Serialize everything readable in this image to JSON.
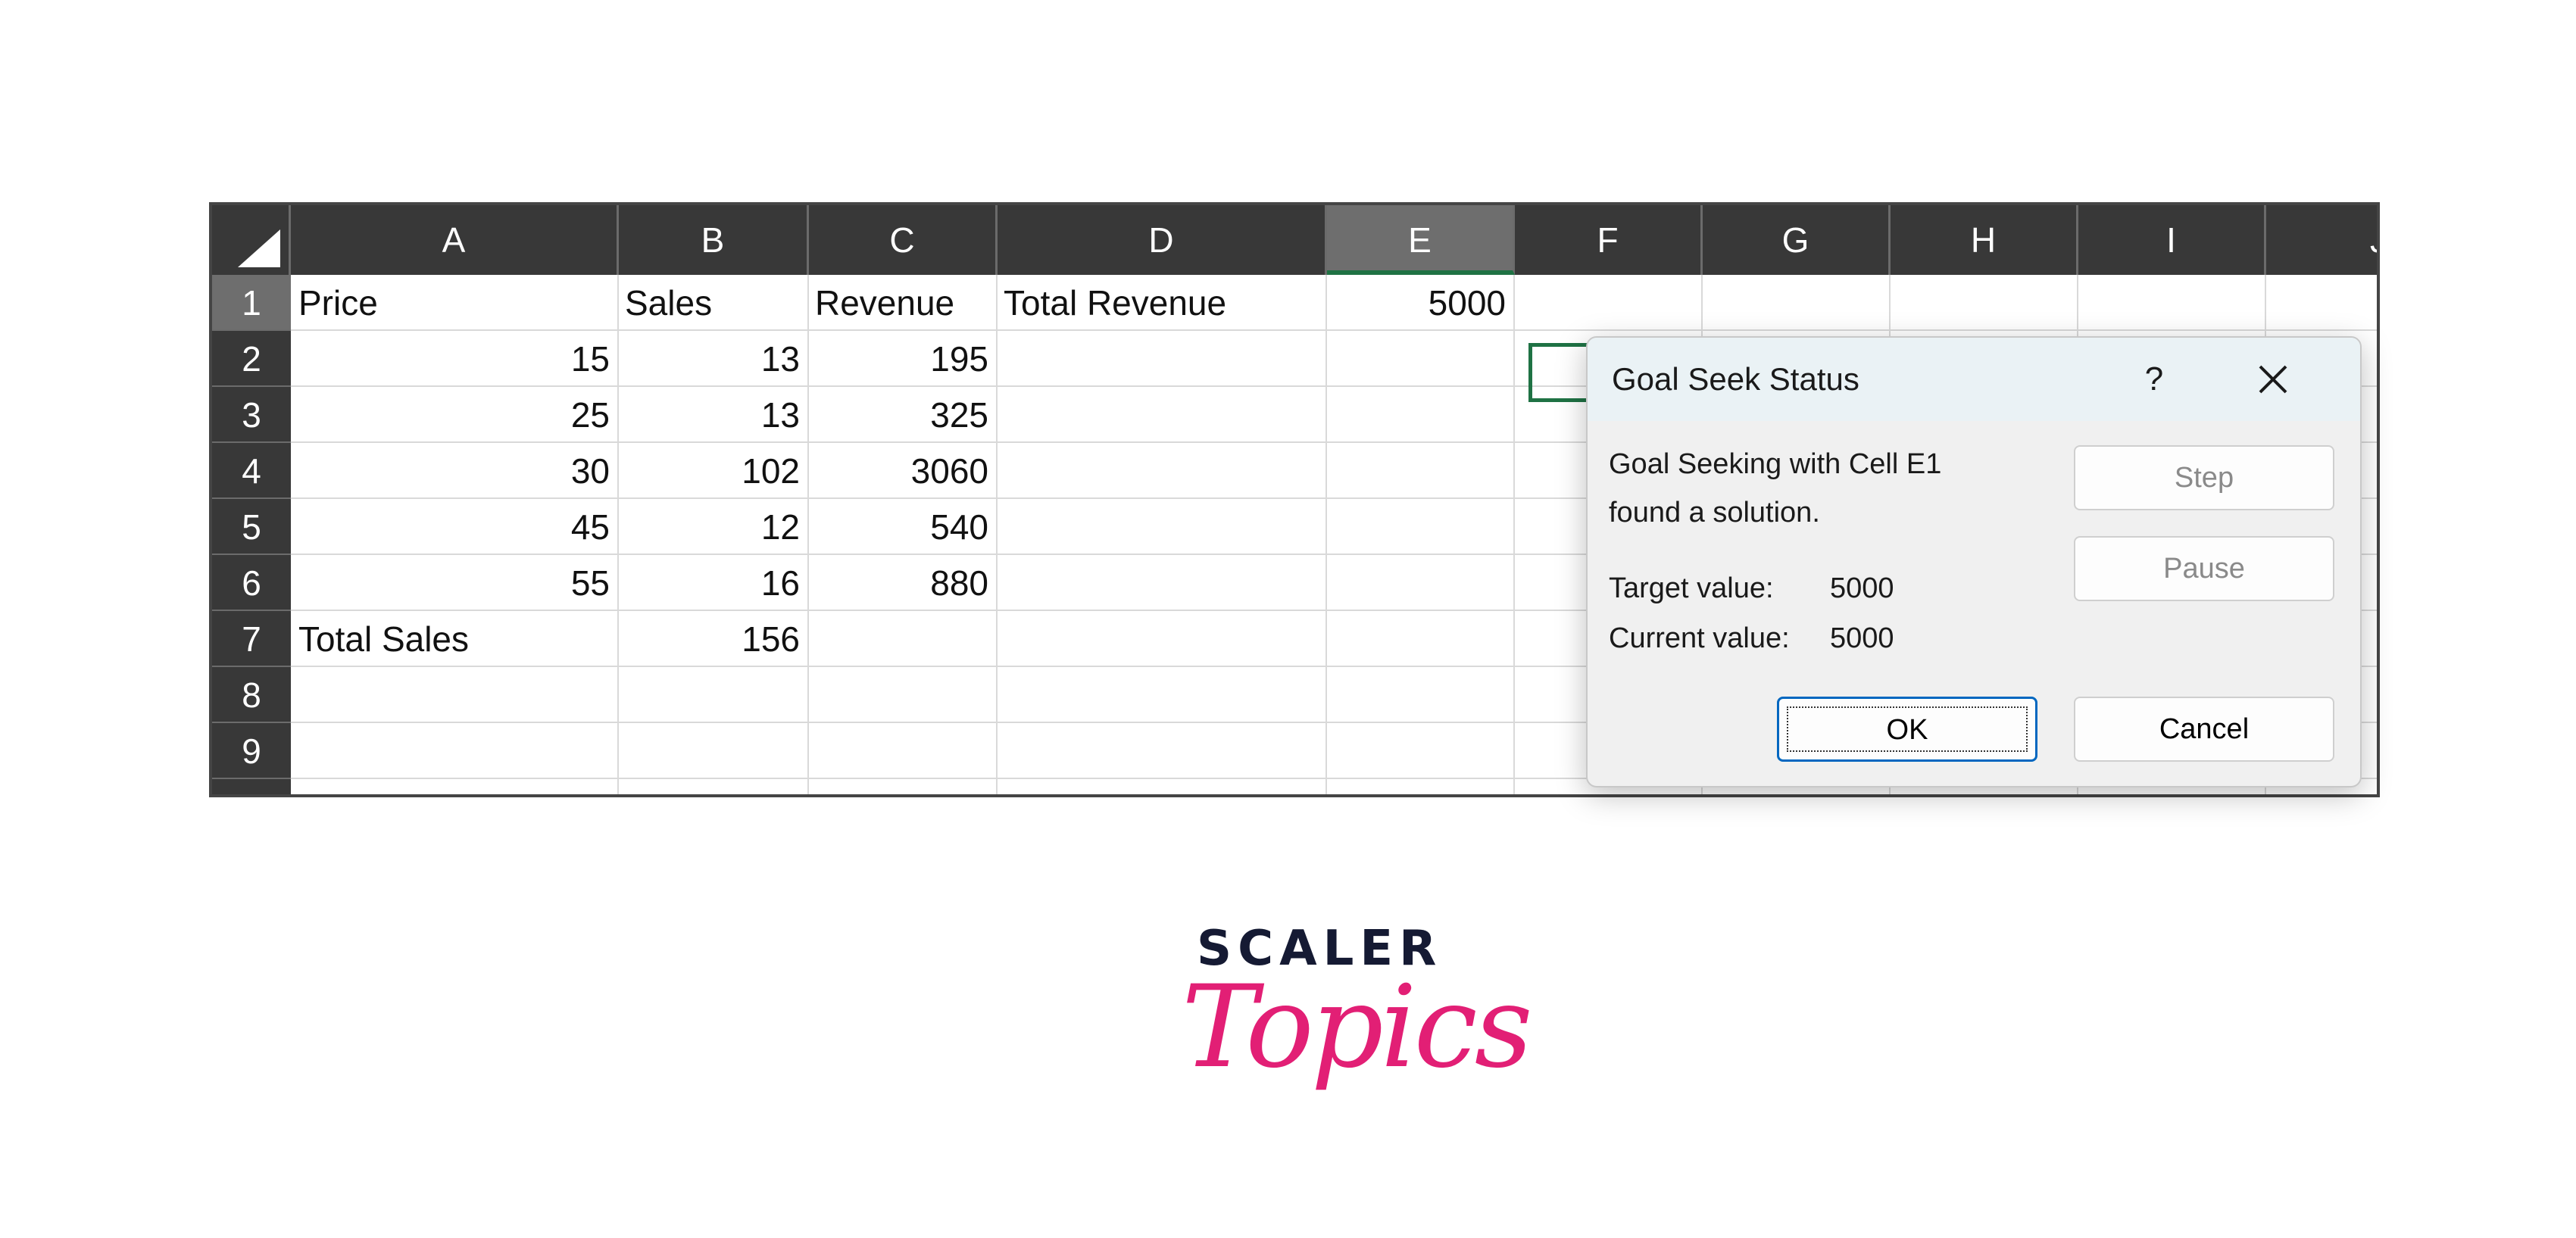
{
  "spreadsheet": {
    "columns": [
      "A",
      "B",
      "C",
      "D",
      "E",
      "F",
      "G",
      "H",
      "I",
      "J"
    ],
    "selected_column": "E",
    "rows": [
      "1",
      "2",
      "3",
      "4",
      "5",
      "6",
      "7",
      "8",
      "9"
    ],
    "selected_row": "1",
    "cells": {
      "r1": {
        "a": "Price",
        "b": "Sales",
        "c": "Revenue",
        "d": "Total Revenue",
        "e": "5000"
      },
      "r2": {
        "a": "15",
        "b": "13",
        "c": "195"
      },
      "r3": {
        "a": "25",
        "b": "13",
        "c": "325"
      },
      "r4": {
        "a": "30",
        "b": "102",
        "c": "3060"
      },
      "r5": {
        "a": "45",
        "b": "12",
        "c": "540"
      },
      "r6": {
        "a": "55",
        "b": "16",
        "c": "880"
      },
      "r7": {
        "a": "Total Sales",
        "b": "156"
      }
    },
    "active_cell": "E1"
  },
  "dialog": {
    "title": "Goal Seek Status",
    "help": "?",
    "message_line1": "Goal Seeking with Cell E1",
    "message_line2": "found a solution.",
    "target_label": "Target value:",
    "target_value": "5000",
    "current_label": "Current value:",
    "current_value": "5000",
    "buttons": {
      "step": "Step",
      "pause": "Pause",
      "ok": "OK",
      "cancel": "Cancel"
    },
    "close_icon": "close-icon"
  },
  "logo": {
    "top": "SCALER",
    "bottom": "Topics"
  },
  "colors": {
    "accent_green": "#1f7244",
    "header_dark": "#383838",
    "logo_pink": "#e21f75",
    "logo_navy": "#151a33",
    "ok_border": "#0067c0"
  }
}
